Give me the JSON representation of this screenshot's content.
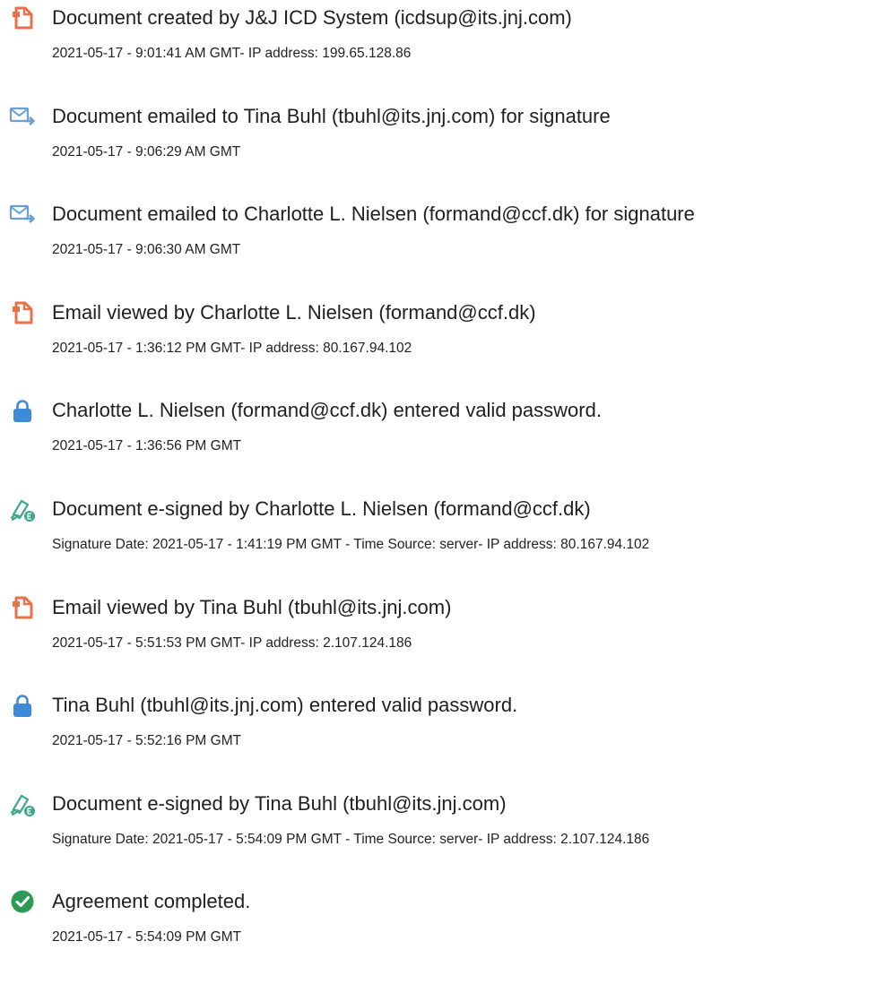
{
  "colors": {
    "document_icon": "#e8704a",
    "email_icon": "#6a9fd6",
    "lock_icon": "#3c8ad8",
    "esign_icon": "#3ea88a",
    "complete_icon": "#2e9a57",
    "text": "#1f1f1f"
  },
  "events": [
    {
      "icon": "document-icon",
      "title": "Document created by J&J ICD System (icdsup@its.jnj.com)",
      "detail": "2021-05-17 - 9:01:41 AM GMT- IP address: 199.65.128.86"
    },
    {
      "icon": "email-sent-icon",
      "title": "Document emailed to Tina Buhl (tbuhl@its.jnj.com) for signature",
      "detail": "2021-05-17 - 9:06:29 AM GMT"
    },
    {
      "icon": "email-sent-icon",
      "title": "Document emailed to Charlotte L. Nielsen (formand@ccf.dk) for signature",
      "detail": "2021-05-17 - 9:06:30 AM GMT"
    },
    {
      "icon": "document-icon",
      "title": "Email viewed by Charlotte L. Nielsen (formand@ccf.dk)",
      "detail": "2021-05-17 - 1:36:12 PM GMT- IP address: 80.167.94.102"
    },
    {
      "icon": "lock-icon",
      "title": "Charlotte L. Nielsen (formand@ccf.dk) entered valid password.",
      "detail": "2021-05-17 - 1:36:56 PM GMT"
    },
    {
      "icon": "esign-pen-icon",
      "title": "Document e-signed by Charlotte L. Nielsen (formand@ccf.dk)",
      "detail": "Signature Date: 2021-05-17 - 1:41:19 PM GMT - Time Source: server- IP address: 80.167.94.102"
    },
    {
      "icon": "document-icon",
      "title": "Email viewed by Tina Buhl (tbuhl@its.jnj.com)",
      "detail": "2021-05-17 - 5:51:53 PM GMT- IP address: 2.107.124.186"
    },
    {
      "icon": "lock-icon",
      "title": "Tina Buhl (tbuhl@its.jnj.com) entered valid password.",
      "detail": "2021-05-17 - 5:52:16 PM GMT"
    },
    {
      "icon": "esign-pen-icon",
      "title": "Document e-signed by Tina Buhl (tbuhl@its.jnj.com)",
      "detail": "Signature Date: 2021-05-17 - 5:54:09 PM GMT - Time Source: server- IP address: 2.107.124.186"
    },
    {
      "icon": "checkmark-circle-icon",
      "title": "Agreement completed.",
      "detail": "2021-05-17 - 5:54:09 PM GMT"
    }
  ]
}
